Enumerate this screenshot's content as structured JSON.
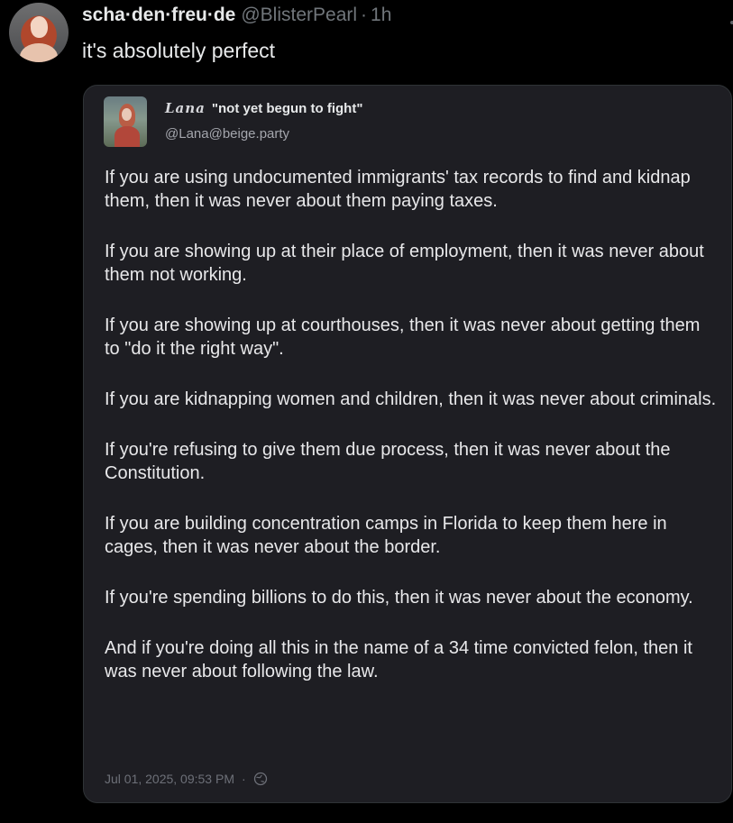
{
  "post": {
    "display_name": "scha·den·freu·de",
    "handle": "@BlisterPearl",
    "separator": "·",
    "time": "1h",
    "text": "it's absolutely perfect"
  },
  "quoted": {
    "name": "Lana",
    "status": "\"not yet begun to fight\"",
    "handle": "@Lana@beige.party",
    "paragraphs": [
      "If you are using undocumented immigrants' tax records to find and kidnap them, then it was never about them paying taxes.",
      "If you are showing up at their place of employment, then it was never about them not working.",
      "If you are showing up at courthouses, then it was never about getting them to \"do it the right way\".",
      "If you are kidnapping women and children, then it was never about criminals.",
      "If you're refusing to give them due process, then it was never about the Constitution.",
      "If you are building concentration camps in Florida to keep them here in cages, then it was never about the border.",
      "If you're spending billions to do this, then it was never about the economy.",
      "And if you're doing all this in the name of a 34 time convicted felon, then it was never about following the law."
    ],
    "timestamp": "Jul 01, 2025, 09:53 PM",
    "footer_separator": "·",
    "visibility_icon": "globe-icon"
  },
  "colors": {
    "background": "#000000",
    "text_primary": "#e7e9ea",
    "text_secondary": "#71767b",
    "card_background": "#1e1e23"
  }
}
